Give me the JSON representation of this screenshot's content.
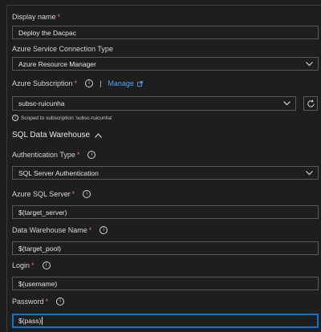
{
  "display_name": {
    "label": "Display name",
    "required": "*",
    "value": "Deploy the Dacpac"
  },
  "connection_type": {
    "label": "Azure Service Connection Type",
    "value": "Azure Resource Manager"
  },
  "subscription": {
    "label": "Azure Subscription",
    "required": "*",
    "separator": "|",
    "manage_label": "Manage",
    "value": "subsc-ruicunha",
    "scope_note": "Scoped to subscription 'subsc-ruicunha'"
  },
  "section": {
    "title": "SQL Data Warehouse"
  },
  "auth_type": {
    "label": "Authentication Type",
    "required": "*",
    "value": "SQL Server Authentication"
  },
  "sql_server": {
    "label": "Azure SQL Server",
    "required": "*",
    "value": "$(target_server)"
  },
  "warehouse_name": {
    "label": "Data Warehouse Name",
    "required": "*",
    "value": "$(target_pool)"
  },
  "login": {
    "label": "Login",
    "required": "*",
    "value": "$(username)"
  },
  "password": {
    "label": "Password",
    "required": "*",
    "value": "$(pass)"
  },
  "icons": {
    "info": "info-icon",
    "chevron": "chevron-down-icon",
    "external": "external-link-icon",
    "refresh": "refresh-icon",
    "collapse": "chevron-up-icon"
  },
  "colors": {
    "background": "#1e1e1e",
    "border": "#5a5a5a",
    "accent": "#0078d4",
    "link": "#4fa3f7",
    "required": "#f1707b"
  }
}
